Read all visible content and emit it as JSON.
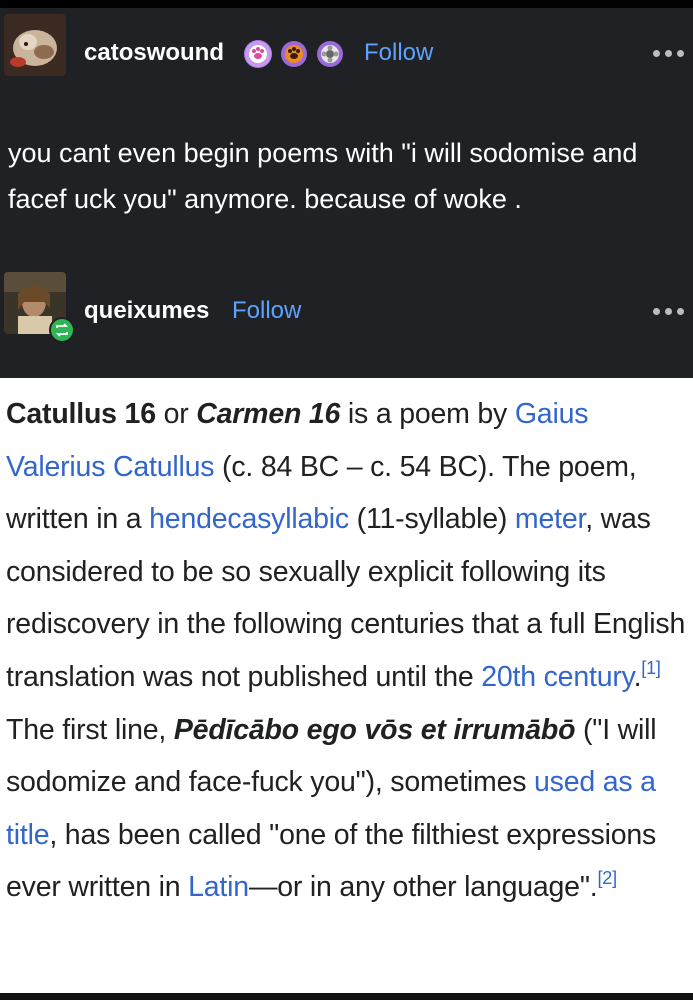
{
  "post1": {
    "username": "catoswound",
    "follow_label": "Follow",
    "badges": [
      "paw-badge-icon",
      "paw-badge-icon",
      "flower-badge-icon"
    ],
    "text": "you cant even begin poems with \"i will sodomise and facef uck you\" anymore. because of woke ."
  },
  "post2": {
    "username": "queixumes",
    "follow_label": "Follow"
  },
  "wiki": {
    "t1": "Catullus 16",
    "t2": " or ",
    "t3": "Carmen 16",
    "t4": " is a poem by ",
    "l1": "Gaius Valerius Catullus",
    "t5": " (c. 84 BC – c. 54 BC). The poem, written in a ",
    "l2": "hendecasyllabic",
    "t6": " (11-syllable) ",
    "l3": "meter",
    "t7": ", was considered to be so sexually explicit following its rediscovery in the following centuries that a full English translation was not published until the ",
    "l4": "20th century",
    "t8": ".",
    "ref1": "[1]",
    "t9": " The first line, ",
    "t10": "Pēdīcābo ego vōs et irrumābō",
    "t11": " (\"I will sodomize and face-fuck you\"), sometimes ",
    "l5": "used as a title",
    "t12": ", has been called \"one of the filthiest expressions ever written in ",
    "l6": "Latin",
    "t13": "—or in any other language\".",
    "ref2": "[2]"
  },
  "colors": {
    "dark_bg": "#202124",
    "follow": "#5da2ff",
    "wiki_link": "#3366cc",
    "reblog_badge": "#2fb553"
  }
}
